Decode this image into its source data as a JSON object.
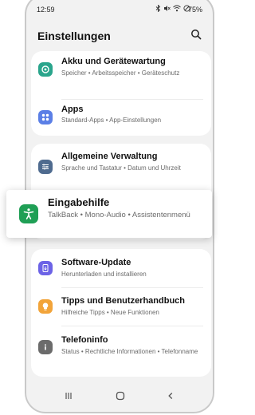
{
  "status_bar": {
    "time": "12:59",
    "battery": "75%",
    "icons": [
      "bluetooth-icon",
      "mute-icon",
      "wifi-icon",
      "dnd-icon"
    ]
  },
  "header": {
    "title": "Einstellungen",
    "search_icon": "search-icon"
  },
  "groups": [
    {
      "items": [
        {
          "title": "Akku und Gerätewartung",
          "subtitle": "Speicher  •  Arbeitsspeicher  •  Geräteschutz",
          "icon": "device-care-icon",
          "color": "#2aa58c"
        },
        {
          "title": "Apps",
          "subtitle": "Standard-Apps  •  App-Einstellungen",
          "icon": "apps-icon",
          "color": "#5b7fe6"
        }
      ]
    },
    {
      "items": [
        {
          "title": "Allgemeine Verwaltung",
          "subtitle": "Sprache und Tastatur  •  Datum und Uhrzeit",
          "icon": "general-management-icon",
          "color": "#4f6b8f"
        }
      ]
    },
    {
      "items": [
        {
          "title": "Software-Update",
          "subtitle": "Herunterladen und installieren",
          "icon": "software-update-icon",
          "color": "#6c63e6"
        },
        {
          "title": "Tipps und Benutzerhandbuch",
          "subtitle": "Hilfreiche Tipps  •  Neue Funktionen",
          "icon": "tips-icon",
          "color": "#f2a43a"
        },
        {
          "title": "Telefoninfo",
          "subtitle": "Status  •  Rechtliche Informationen  •  Telefonname",
          "icon": "info-icon",
          "color": "#6b6b6b"
        }
      ]
    }
  ],
  "highlight": {
    "title": "Eingabehilfe",
    "subtitle": "TalkBack  •  Mono-Audio  •  Assistentenmenü",
    "icon": "accessibility-icon",
    "color": "#1f9f55"
  },
  "nav_bar": {
    "buttons": [
      "recents-icon",
      "home-icon",
      "back-icon"
    ]
  }
}
